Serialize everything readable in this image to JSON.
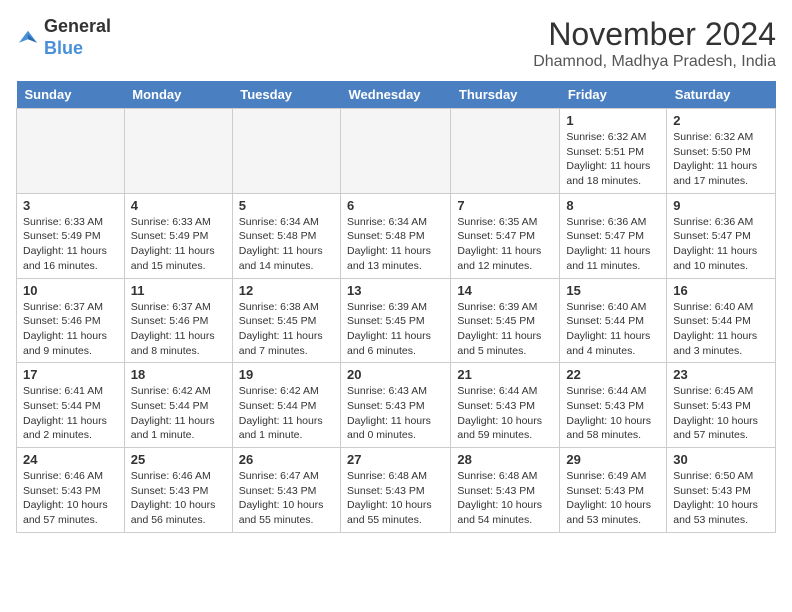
{
  "header": {
    "logo_general": "General",
    "logo_blue": "Blue",
    "month": "November 2024",
    "location": "Dhamnod, Madhya Pradesh, India"
  },
  "days_of_week": [
    "Sunday",
    "Monday",
    "Tuesday",
    "Wednesday",
    "Thursday",
    "Friday",
    "Saturday"
  ],
  "weeks": [
    [
      {
        "day": "",
        "info": ""
      },
      {
        "day": "",
        "info": ""
      },
      {
        "day": "",
        "info": ""
      },
      {
        "day": "",
        "info": ""
      },
      {
        "day": "",
        "info": ""
      },
      {
        "day": "1",
        "info": "Sunrise: 6:32 AM\nSunset: 5:51 PM\nDaylight: 11 hours and 18 minutes."
      },
      {
        "day": "2",
        "info": "Sunrise: 6:32 AM\nSunset: 5:50 PM\nDaylight: 11 hours and 17 minutes."
      }
    ],
    [
      {
        "day": "3",
        "info": "Sunrise: 6:33 AM\nSunset: 5:49 PM\nDaylight: 11 hours and 16 minutes."
      },
      {
        "day": "4",
        "info": "Sunrise: 6:33 AM\nSunset: 5:49 PM\nDaylight: 11 hours and 15 minutes."
      },
      {
        "day": "5",
        "info": "Sunrise: 6:34 AM\nSunset: 5:48 PM\nDaylight: 11 hours and 14 minutes."
      },
      {
        "day": "6",
        "info": "Sunrise: 6:34 AM\nSunset: 5:48 PM\nDaylight: 11 hours and 13 minutes."
      },
      {
        "day": "7",
        "info": "Sunrise: 6:35 AM\nSunset: 5:47 PM\nDaylight: 11 hours and 12 minutes."
      },
      {
        "day": "8",
        "info": "Sunrise: 6:36 AM\nSunset: 5:47 PM\nDaylight: 11 hours and 11 minutes."
      },
      {
        "day": "9",
        "info": "Sunrise: 6:36 AM\nSunset: 5:47 PM\nDaylight: 11 hours and 10 minutes."
      }
    ],
    [
      {
        "day": "10",
        "info": "Sunrise: 6:37 AM\nSunset: 5:46 PM\nDaylight: 11 hours and 9 minutes."
      },
      {
        "day": "11",
        "info": "Sunrise: 6:37 AM\nSunset: 5:46 PM\nDaylight: 11 hours and 8 minutes."
      },
      {
        "day": "12",
        "info": "Sunrise: 6:38 AM\nSunset: 5:45 PM\nDaylight: 11 hours and 7 minutes."
      },
      {
        "day": "13",
        "info": "Sunrise: 6:39 AM\nSunset: 5:45 PM\nDaylight: 11 hours and 6 minutes."
      },
      {
        "day": "14",
        "info": "Sunrise: 6:39 AM\nSunset: 5:45 PM\nDaylight: 11 hours and 5 minutes."
      },
      {
        "day": "15",
        "info": "Sunrise: 6:40 AM\nSunset: 5:44 PM\nDaylight: 11 hours and 4 minutes."
      },
      {
        "day": "16",
        "info": "Sunrise: 6:40 AM\nSunset: 5:44 PM\nDaylight: 11 hours and 3 minutes."
      }
    ],
    [
      {
        "day": "17",
        "info": "Sunrise: 6:41 AM\nSunset: 5:44 PM\nDaylight: 11 hours and 2 minutes."
      },
      {
        "day": "18",
        "info": "Sunrise: 6:42 AM\nSunset: 5:44 PM\nDaylight: 11 hours and 1 minute."
      },
      {
        "day": "19",
        "info": "Sunrise: 6:42 AM\nSunset: 5:44 PM\nDaylight: 11 hours and 1 minute."
      },
      {
        "day": "20",
        "info": "Sunrise: 6:43 AM\nSunset: 5:43 PM\nDaylight: 11 hours and 0 minutes."
      },
      {
        "day": "21",
        "info": "Sunrise: 6:44 AM\nSunset: 5:43 PM\nDaylight: 10 hours and 59 minutes."
      },
      {
        "day": "22",
        "info": "Sunrise: 6:44 AM\nSunset: 5:43 PM\nDaylight: 10 hours and 58 minutes."
      },
      {
        "day": "23",
        "info": "Sunrise: 6:45 AM\nSunset: 5:43 PM\nDaylight: 10 hours and 57 minutes."
      }
    ],
    [
      {
        "day": "24",
        "info": "Sunrise: 6:46 AM\nSunset: 5:43 PM\nDaylight: 10 hours and 57 minutes."
      },
      {
        "day": "25",
        "info": "Sunrise: 6:46 AM\nSunset: 5:43 PM\nDaylight: 10 hours and 56 minutes."
      },
      {
        "day": "26",
        "info": "Sunrise: 6:47 AM\nSunset: 5:43 PM\nDaylight: 10 hours and 55 minutes."
      },
      {
        "day": "27",
        "info": "Sunrise: 6:48 AM\nSunset: 5:43 PM\nDaylight: 10 hours and 55 minutes."
      },
      {
        "day": "28",
        "info": "Sunrise: 6:48 AM\nSunset: 5:43 PM\nDaylight: 10 hours and 54 minutes."
      },
      {
        "day": "29",
        "info": "Sunrise: 6:49 AM\nSunset: 5:43 PM\nDaylight: 10 hours and 53 minutes."
      },
      {
        "day": "30",
        "info": "Sunrise: 6:50 AM\nSunset: 5:43 PM\nDaylight: 10 hours and 53 minutes."
      }
    ]
  ]
}
